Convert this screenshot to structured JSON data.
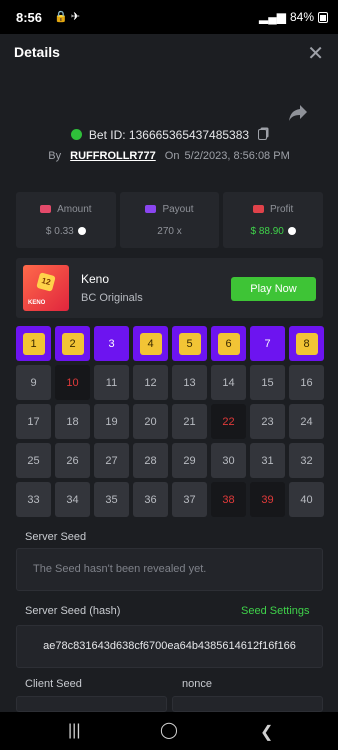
{
  "status_bar": {
    "time": "8:56",
    "battery": "84%"
  },
  "header": {
    "title": "Details"
  },
  "bet": {
    "id_label": "Bet ID: 136665365437485383",
    "by": "By",
    "user": "RUFFROLLR777",
    "on": "On",
    "date": "5/2/2023, 8:56:08 PM"
  },
  "stats": [
    {
      "label": "Amount",
      "value": "$ 0.33",
      "color": "#e34a6a"
    },
    {
      "label": "Payout",
      "value": "270 x",
      "color": "#8a45f0"
    },
    {
      "label": "Profit",
      "value": "$ 88.90",
      "color": "#e0424a"
    }
  ],
  "game": {
    "name": "Keno",
    "provider": "BC Originals",
    "play_label": "Play Now",
    "thumb_chip": "12",
    "thumb_label": "KENO"
  },
  "keno": {
    "cells": [
      {
        "n": "1",
        "s": "hit"
      },
      {
        "n": "2",
        "s": "hit"
      },
      {
        "n": "3",
        "s": "sel"
      },
      {
        "n": "4",
        "s": "hit"
      },
      {
        "n": "5",
        "s": "hit"
      },
      {
        "n": "6",
        "s": "hit"
      },
      {
        "n": "7",
        "s": "sel"
      },
      {
        "n": "8",
        "s": "hit"
      },
      {
        "n": "9",
        "s": ""
      },
      {
        "n": "10",
        "s": "dark"
      },
      {
        "n": "11",
        "s": ""
      },
      {
        "n": "12",
        "s": ""
      },
      {
        "n": "13",
        "s": ""
      },
      {
        "n": "14",
        "s": ""
      },
      {
        "n": "15",
        "s": ""
      },
      {
        "n": "16",
        "s": ""
      },
      {
        "n": "17",
        "s": ""
      },
      {
        "n": "18",
        "s": ""
      },
      {
        "n": "19",
        "s": ""
      },
      {
        "n": "20",
        "s": ""
      },
      {
        "n": "21",
        "s": ""
      },
      {
        "n": "22",
        "s": "dark"
      },
      {
        "n": "23",
        "s": ""
      },
      {
        "n": "24",
        "s": ""
      },
      {
        "n": "25",
        "s": ""
      },
      {
        "n": "26",
        "s": ""
      },
      {
        "n": "27",
        "s": ""
      },
      {
        "n": "28",
        "s": ""
      },
      {
        "n": "29",
        "s": ""
      },
      {
        "n": "30",
        "s": ""
      },
      {
        "n": "31",
        "s": ""
      },
      {
        "n": "32",
        "s": ""
      },
      {
        "n": "33",
        "s": ""
      },
      {
        "n": "34",
        "s": ""
      },
      {
        "n": "35",
        "s": ""
      },
      {
        "n": "36",
        "s": ""
      },
      {
        "n": "37",
        "s": ""
      },
      {
        "n": "38",
        "s": "dark"
      },
      {
        "n": "39",
        "s": "dark"
      },
      {
        "n": "40",
        "s": ""
      }
    ]
  },
  "seeds": {
    "server_seed_label": "Server Seed",
    "server_seed_value": "The Seed hasn't been revealed yet.",
    "server_hash_label": "Server Seed (hash)",
    "seed_settings": "Seed Settings",
    "server_hash_value": "ae78c831643d638cf6700ea64b4385614612f16f166",
    "client_seed_label": "Client Seed",
    "nonce_label": "nonce"
  }
}
